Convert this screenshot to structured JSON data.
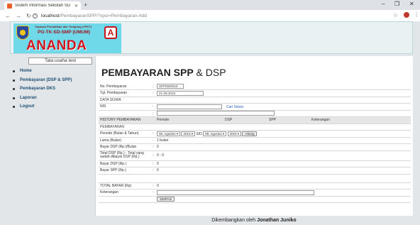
{
  "browser": {
    "tab_title": "Sistem Informasi Sekolah SD",
    "url_host": "localhost",
    "url_path": "/PembayaranSPP/?opsi=Pembayaran-Add"
  },
  "header": {
    "foundation": "Yayasan Pendidikan dan Terapung (YPKT)",
    "school": "PG-TK-SD-SMP (UMUM)",
    "badge": "A",
    "brand": "ANANDA"
  },
  "sidebar": {
    "user": "Tata usaha test",
    "items": [
      {
        "label": "Home"
      },
      {
        "label": "Pembayaran (DSP & SPP)"
      },
      {
        "label": "Pembayaran DKS"
      },
      {
        "label": "Laporan"
      },
      {
        "label": "Logout"
      }
    ]
  },
  "page": {
    "title_bold": "PEMBAYARAN SPP",
    "title_rest": " & DSP"
  },
  "form": {
    "no_label": "No. Pembayaran",
    "no_value": "SPP0000019",
    "tgl_label": "Tgl. Pembayaran",
    "tgl_value": "21-09-2019",
    "data_siswa": "DATA SISWA",
    "nis_label": "NIS",
    "cari_label": "Cari Siswa",
    "history_label": "HISTORY PEMBAYARAN",
    "history_cols": [
      "Periode",
      "DSP",
      "SPP",
      "Keterangan"
    ],
    "pembayaran_label": "PEMBAYARAN",
    "periode_label": "Periode (Bulan & Tahun)",
    "bulan_from": "08. Agustus",
    "tahun_from": "2019",
    "sd_label": "S/D",
    "bulan_to": "08. Agustus",
    "tahun_to": "2019",
    "hitung_label": "Hitung",
    "lama_label": "Lama (Bulan)",
    "lama_value": "1 bulan",
    "bayar_dsp_bulan_label": "Bayar DSP (Rp.)/Bulan",
    "bayar_dsp_bulan_value": "0",
    "total_dsp_label": "Total DSP (Rp.) - Total yang sudah dibayar DSP (Rp.)",
    "total_dsp_value": "0 - 0",
    "bayar_dsp_label": "Bayar DSP (Rp.)",
    "bayar_dsp_value": "0",
    "bayar_spp_label": "Bayar SPP (Rp.)",
    "bayar_spp_value": "0",
    "total_bayar_label": "TOTAL BAYAR (Rp)",
    "total_bayar_value": "0",
    "keterangan_label": "Keterangan",
    "simpan_label": "SIMPAN"
  },
  "footer": {
    "prefix": "Dikembangkan oleh ",
    "author": "Jonathan Juniko"
  }
}
